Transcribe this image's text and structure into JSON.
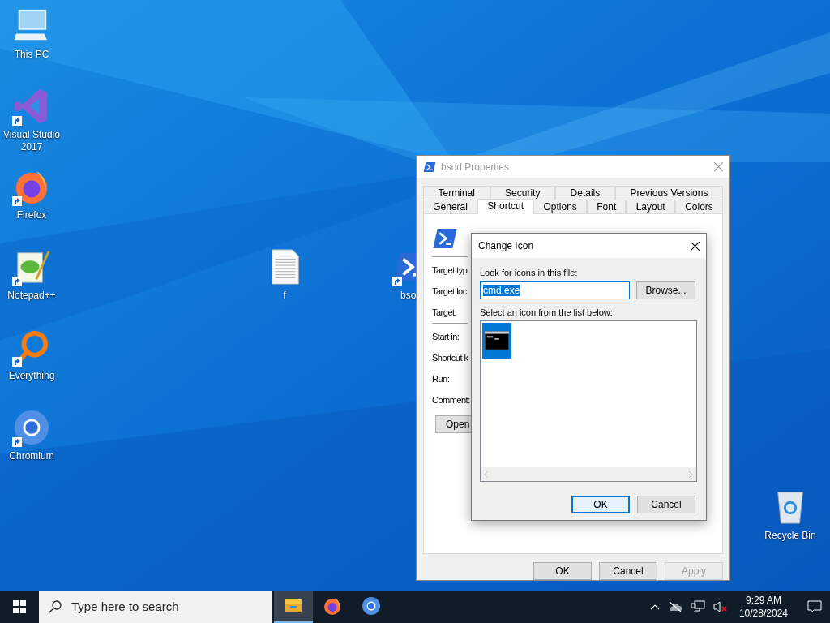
{
  "desktop_icons": [
    {
      "label": "This PC",
      "kind": "computer",
      "shortcut": false
    },
    {
      "label": "Visual Studio 2017",
      "kind": "visual-studio",
      "shortcut": true
    },
    {
      "label": "Firefox",
      "kind": "firefox",
      "shortcut": true
    },
    {
      "label": "Notepad++",
      "kind": "notepad",
      "shortcut": true
    },
    {
      "label": "Everything",
      "kind": "everything",
      "shortcut": true
    },
    {
      "label": "Chromium",
      "kind": "chromium",
      "shortcut": true
    }
  ],
  "desktop_files": [
    {
      "label": "f",
      "kind": "text-file",
      "shortcut": false
    },
    {
      "label": "bso",
      "kind": "powershell",
      "shortcut": true
    }
  ],
  "recycle_bin": {
    "label": "Recycle Bin"
  },
  "properties_window": {
    "title": "bsod Properties",
    "active": false,
    "tab_rows": [
      [
        {
          "label": "Terminal",
          "selected": false
        },
        {
          "label": "Security",
          "selected": false
        },
        {
          "label": "Details",
          "selected": false
        },
        {
          "label": "Previous Versions",
          "selected": false
        }
      ],
      [
        {
          "label": "General",
          "selected": false
        },
        {
          "label": "Shortcut",
          "selected": true
        },
        {
          "label": "Options",
          "selected": false
        },
        {
          "label": "Font",
          "selected": false
        },
        {
          "label": "Layout",
          "selected": false
        },
        {
          "label": "Colors",
          "selected": false
        }
      ]
    ],
    "field_groups": [
      [
        "Target typ",
        "Target loc",
        "Target:"
      ],
      [
        "Start in:",
        "Shortcut k",
        "Run:",
        "Comment:"
      ]
    ],
    "open_button": "Open",
    "buttons": [
      {
        "label": "OK",
        "disabled": false
      },
      {
        "label": "Cancel",
        "disabled": false
      },
      {
        "label": "Apply",
        "disabled": true
      }
    ]
  },
  "change_icon_dialog": {
    "title": "Change Icon",
    "file_label": "Look for icons in this file:",
    "file_value": "cmd.exe",
    "browse_button": "Browse...",
    "list_label": "Select an icon from the list below:",
    "icons": [
      {
        "kind": "console",
        "selected": true
      }
    ],
    "buttons": [
      {
        "label": "OK",
        "default": true
      },
      {
        "label": "Cancel",
        "default": false
      }
    ]
  },
  "taskbar": {
    "search_placeholder": "Type here to search",
    "apps": [
      {
        "kind": "file-explorer",
        "active": true
      },
      {
        "kind": "firefox",
        "active": false
      },
      {
        "kind": "chromium",
        "active": false
      }
    ],
    "muted": true,
    "time": "9:29 AM",
    "date": "10/28/2024"
  }
}
